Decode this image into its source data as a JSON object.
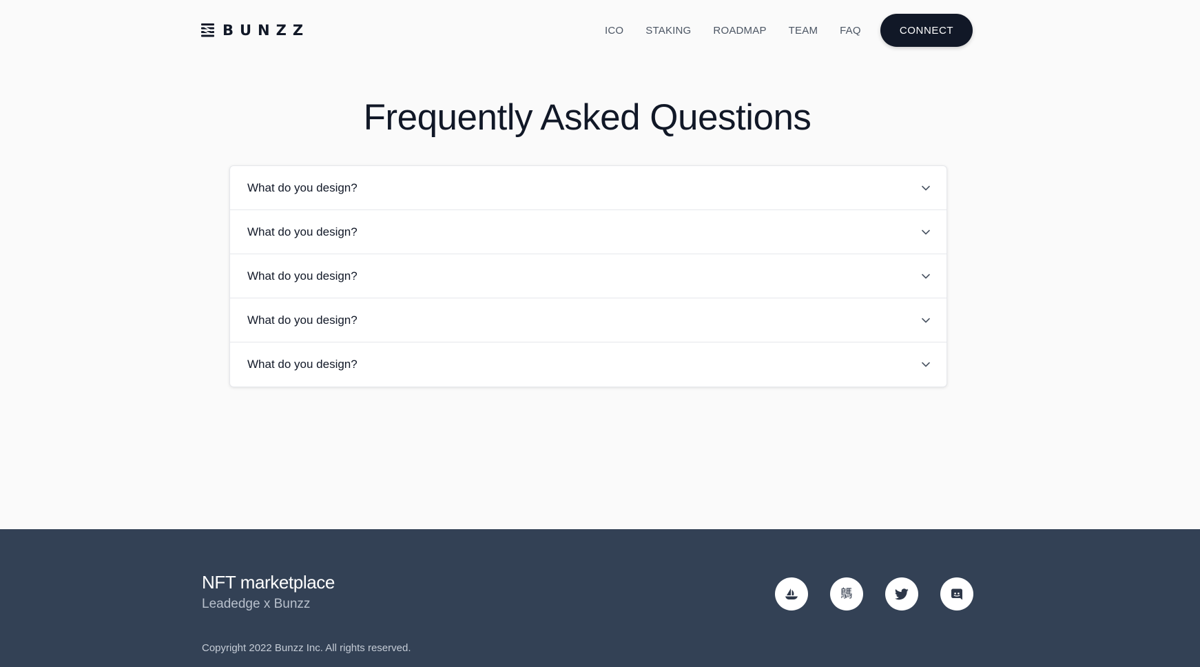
{
  "header": {
    "logo_text": "BUNZZ",
    "logo_icon": "layered-stripes-icon",
    "nav": [
      {
        "label": "ICO"
      },
      {
        "label": "STAKING"
      },
      {
        "label": "ROADMAP"
      },
      {
        "label": "TEAM"
      },
      {
        "label": "FAQ"
      }
    ],
    "connect_label": "CONNECT"
  },
  "main": {
    "title": "Frequently Asked Questions",
    "faq": [
      {
        "question": "What do you design?",
        "expanded": false
      },
      {
        "question": "What do you design?",
        "expanded": false
      },
      {
        "question": "What do you design?",
        "expanded": false
      },
      {
        "question": "What do you design?",
        "expanded": false
      },
      {
        "question": "What do you design?",
        "expanded": false
      }
    ]
  },
  "footer": {
    "title": "NFT marketplace",
    "subtitle": "Leadedge x Bunzz",
    "copyright": "Copyright 2022 Bunzz Inc. All rights reserved.",
    "social": [
      {
        "icon": "opensea-boat-icon"
      },
      {
        "icon": "kanji-icon",
        "glyph": "鷌"
      },
      {
        "icon": "twitter-bird-icon"
      },
      {
        "icon": "discord-icon"
      }
    ]
  },
  "colors": {
    "page_background": "#fafafa",
    "text_primary": "#111827",
    "nav_text": "#4b5563",
    "button_background": "#111827",
    "footer_background": "#334155",
    "divider": "#e5e7eb"
  }
}
